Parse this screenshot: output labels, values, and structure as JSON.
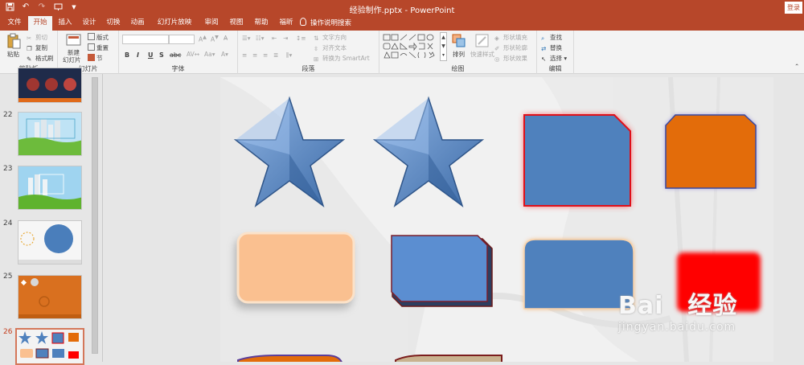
{
  "titlebar": {
    "title": "经验制作.pptx  -  PowerPoint",
    "login": "登录",
    "qat": [
      "save-icon",
      "undo-icon",
      "redo-icon",
      "start-from-beginning-icon",
      "customize-icon"
    ]
  },
  "tabs": [
    {
      "label": "文件",
      "active": false
    },
    {
      "label": "开始",
      "active": true
    },
    {
      "label": "插入",
      "active": false
    },
    {
      "label": "设计",
      "active": false
    },
    {
      "label": "切换",
      "active": false
    },
    {
      "label": "动画",
      "active": false
    },
    {
      "label": "幻灯片放映",
      "active": false
    },
    {
      "label": "审阅",
      "active": false
    },
    {
      "label": "视图",
      "active": false
    },
    {
      "label": "帮助",
      "active": false
    },
    {
      "label": "福昕PDF",
      "active": false
    }
  ],
  "tell_me": "操作说明搜索",
  "ribbon": {
    "clipboard": {
      "label": "剪贴板",
      "paste": "粘贴",
      "cut": "剪切",
      "copy": "复制",
      "format_painter": "格式刷"
    },
    "slides": {
      "label": "幻灯片",
      "new_slide_1": "新建",
      "new_slide_2": "幻灯片",
      "layout": "版式",
      "reset": "重置",
      "section": "节"
    },
    "font": {
      "label": "字体",
      "bold": "B",
      "italic": "I",
      "underline": "U",
      "strike": "S",
      "shadow": "abc"
    },
    "paragraph": {
      "label": "段落",
      "text_direction": "文字方向",
      "align_text": "对齐文本",
      "convert_smartart": "转换为 SmartArt"
    },
    "drawing": {
      "label": "绘图",
      "arrange": "排列",
      "quick_styles": "快速样式",
      "shape_fill": "形状填充",
      "shape_outline": "形状轮廓",
      "shape_effects": "形状效果"
    },
    "editing": {
      "label": "编辑",
      "find": "查找",
      "replace": "替换",
      "select": "选择"
    }
  },
  "slides": [
    {
      "number": "",
      "theme": "dark-circles"
    },
    {
      "number": "22",
      "theme": "city-green"
    },
    {
      "number": "23",
      "theme": "city-blue"
    },
    {
      "number": "24",
      "theme": "blue-circle"
    },
    {
      "number": "25",
      "theme": "orange-wood"
    },
    {
      "number": "26",
      "theme": "shapes",
      "active": true
    }
  ],
  "colors": {
    "accent": "#b7472a",
    "shape_blue": "#4f81bd",
    "shape_orange": "#e36c0a",
    "shape_peach": "#fac090",
    "shape_red": "#ff0000"
  },
  "watermark": {
    "brand": "Bai",
    "brand_suffix": "经验",
    "url": "jingyan.baidu.com"
  }
}
